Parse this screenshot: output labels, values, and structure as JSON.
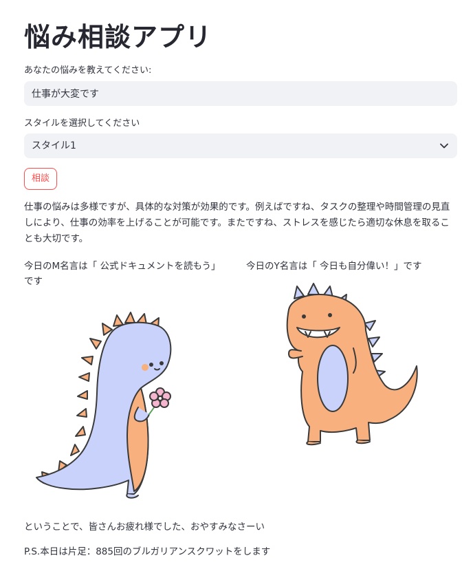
{
  "app": {
    "title": "悩み相談アプリ"
  },
  "form": {
    "worry_label": "あなたの悩みを教えてください:",
    "worry_value": "仕事が大変です",
    "style_label": "スタイルを選択してください",
    "style_selected": "スタイル1",
    "consult_button": "相談"
  },
  "answer": {
    "text": "仕事の悩みは多様ですが、具体的な対策が効果的です。例えばですね、タスクの整理や時間管理の見直しにより、仕事の効率を上げることが可能です。またですね、ストレスを感じたら適切な休息を取ることも大切です。"
  },
  "quotes": {
    "m_quote": "今日のM名言は「 公式ドキュメントを読もう」 です",
    "y_quote": "今日のY名言は「 今日も自分偉い！」です"
  },
  "images": {
    "left": "blue-dinosaur-holding-flower",
    "right": "orange-dinosaur-waving"
  },
  "footer": {
    "closing": "ということで、皆さんお疲れ様でした、おやすみなさーい",
    "ps": "P.S.本日は片足：885回のブルガリアンスクワットをします"
  },
  "colors": {
    "accent": "#ff4b4b",
    "input_bg": "#f0f2f6",
    "text": "#31333f",
    "dino_blue": "#c8d2fa",
    "dino_orange": "#f7b07e"
  }
}
